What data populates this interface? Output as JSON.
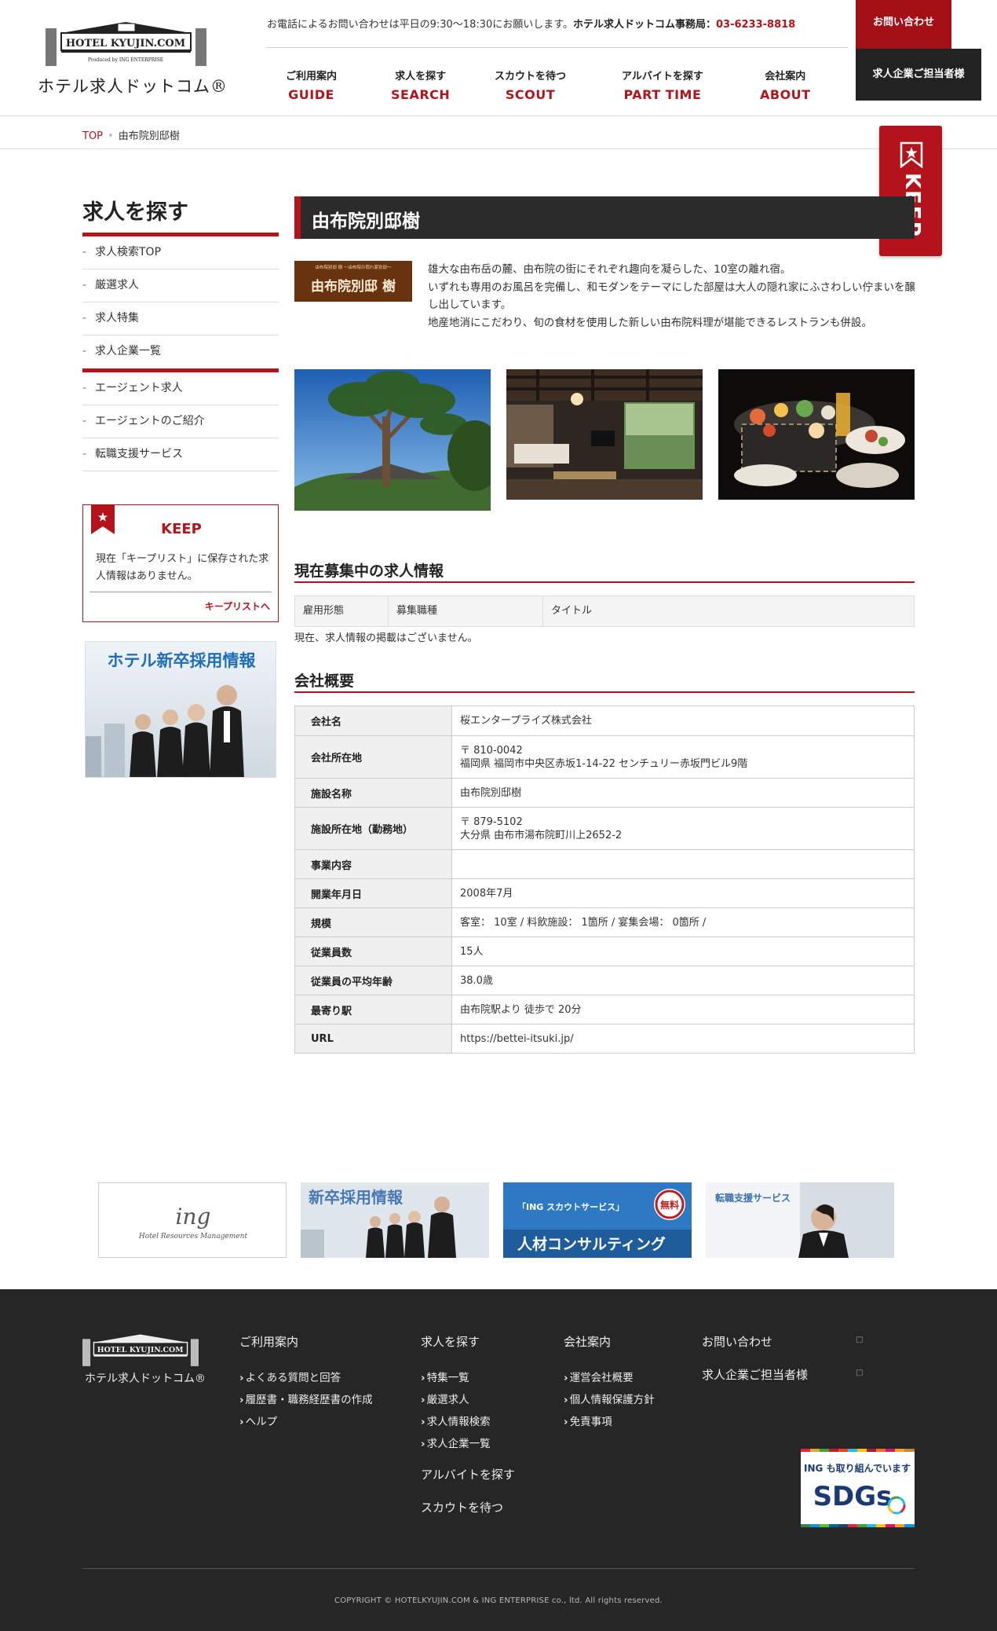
{
  "header": {
    "logo_sign": "HOTEL KYUJIN.COM",
    "logo_sub": "Produced by ING ENTERPRISE",
    "logo_text": "ホテル求人ドットコム®",
    "phone_note": "お電話によるお問い合わせは平日の9:30～18:30にお願いします。",
    "office_label": "ホテル求人ドットコム事務局：",
    "phone_number": "03-6233-8818",
    "nav": [
      {
        "jp": "ご利用案内",
        "en": "GUIDE"
      },
      {
        "jp": "求人を探す",
        "en": "SEARCH"
      },
      {
        "jp": "スカウトを待つ",
        "en": "SCOUT"
      },
      {
        "jp": "アルバイトを探す",
        "en": "PART TIME"
      },
      {
        "jp": "会社案内",
        "en": "ABOUT"
      }
    ],
    "contact_button": "お問い合わせ",
    "corporate_button": "求人企業ご担当者様"
  },
  "breadcrumb": {
    "top": "TOP",
    "current": "由布院別邸樹"
  },
  "keep_tab": {
    "label": "KEEP"
  },
  "sidebar": {
    "title": "求人を探す",
    "group1": [
      "求人検索TOP",
      "厳選求人",
      "求人特集",
      "求人企業一覧"
    ],
    "group2": [
      "エージェント求人",
      "エージェントのご紹介",
      "転職支援サービス"
    ],
    "keep_box": {
      "heading": "KEEP",
      "description": "現在「キープリスト」に保存された求人情報はありません。",
      "link": "キープリストへ"
    },
    "banner_text": "ホテル新卒採用情報"
  },
  "main": {
    "title": "由布院別邸樹",
    "brand_logo_text": "由布院別邸 樹",
    "brand_logo_top": "由布院別邸 樹 ～由布院の隠れ家別邸～",
    "intro_lines": [
      "雄大な由布岳の麓、由布院の街にそれぞれ趣向を凝らした、10室の離れ宿。",
      "いずれも専用のお風呂を完備し、和モダンをテーマにした部屋は大人の隠れ家にふさわしい佇まいを醸し出しています。",
      "地産地消にこだわり、旬の食材を使用した新しい由布院料理が堪能できるレストランも併設。"
    ],
    "jobs": {
      "heading": "現在募集中の求人情報",
      "columns": [
        "雇用形態",
        "募集職種",
        "タイトル"
      ],
      "empty": "現在、求人情報の掲載はございません。"
    },
    "company": {
      "heading": "会社概要",
      "rows": [
        {
          "label": "会社名",
          "value": "桜エンタープライズ株式会社",
          "value2": ""
        },
        {
          "label": "会社所在地",
          "value": "〒 810-0042",
          "value2": "福岡県 福岡市中央区赤坂1-14-22 センチュリー赤坂門ビル9階"
        },
        {
          "label": "施設名称",
          "value": "由布院別邸樹",
          "value2": ""
        },
        {
          "label": "施設所在地（勤務地）",
          "value": "〒 879-5102",
          "value2": "大分県 由布市湯布院町川上2652-2"
        },
        {
          "label": "事業内容",
          "value": "",
          "value2": ""
        },
        {
          "label": "開業年月日",
          "value": "2008年7月",
          "value2": ""
        },
        {
          "label": "規模",
          "value": "客室： 10室 / 料飲施設： 1箇所 / 宴集会場： 0箇所 /",
          "value2": ""
        },
        {
          "label": "従業員数",
          "value": "15人",
          "value2": ""
        },
        {
          "label": "従業員の平均年齢",
          "value": "38.0歳",
          "value2": ""
        },
        {
          "label": "最寄り駅",
          "value": "由布院駅より 徒歩で 20分",
          "value2": ""
        },
        {
          "label": "URL",
          "value": "https://bettei-itsuki.jp/",
          "value2": ""
        }
      ]
    }
  },
  "bottom_banners": {
    "ing_logo": "ing",
    "ing_sub": "Hotel Resources Management",
    "newgrad": "新卒採用情報",
    "scout_top": "「ING スカウトサービス」",
    "scout_main": "人材コンサルティング",
    "scout_stamp": "無料",
    "career": "転職支援サービス"
  },
  "footer": {
    "logo_text": "ホテル求人ドットコム®",
    "col1": {
      "heading": "ご利用案内",
      "links": [
        "よくある質問と回答",
        "履歴書・職務経歴書の作成",
        "ヘルプ"
      ]
    },
    "col2": {
      "heading": "求人を探す",
      "links": [
        "特集一覧",
        "厳選求人",
        "求人情報検索",
        "求人企業一覧"
      ],
      "extra": [
        "アルバイトを探す",
        "スカウトを待つ"
      ]
    },
    "col3": {
      "heading": "会社案内",
      "links": [
        "運営会社概要",
        "個人情報保護方針",
        "免責事項"
      ]
    },
    "col4": {
      "links": [
        "お問い合わせ",
        "求人企業ご担当者様"
      ],
      "icon": "□"
    },
    "sdgs_top": "ING も取り組んでいます",
    "sdgs_main": "SDGs",
    "copyright": "COPYRIGHT © HOTELKYUJIN.COM & ING ENTERPRISE co., ltd. All rights reserved."
  }
}
